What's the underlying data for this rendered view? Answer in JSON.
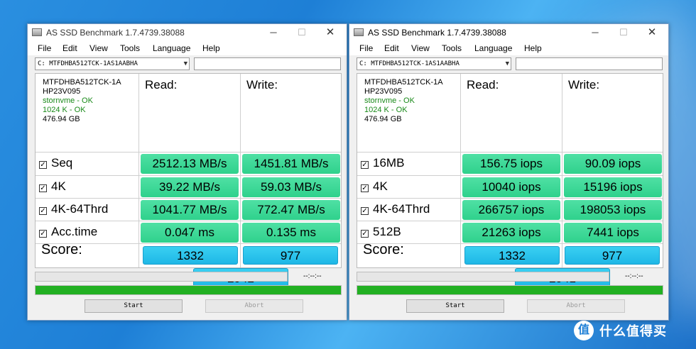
{
  "windows": [
    {
      "title": "AS SSD Benchmark 1.7.4739.38088",
      "menu": [
        "File",
        "Edit",
        "View",
        "Tools",
        "Language",
        "Help"
      ],
      "drive": "C: MTFDHBA512TCK-1AS1AABHA",
      "info": {
        "model": "MTFDHBA512TCK-1A",
        "firmware": "HP23V095",
        "driver": "stornvme - OK",
        "alignment": "1024 K - OK",
        "size": "476.94 GB"
      },
      "read_label": "Read:",
      "write_label": "Write:",
      "rows": [
        {
          "label": "Seq",
          "read": "2512.13 MB/s",
          "write": "1451.81 MB/s"
        },
        {
          "label": "4K",
          "read": "39.22 MB/s",
          "write": "59.03 MB/s"
        },
        {
          "label": "4K-64Thrd",
          "read": "1041.77 MB/s",
          "write": "772.47 MB/s"
        },
        {
          "label": "Acc.time",
          "read": "0.047 ms",
          "write": "0.135 ms"
        }
      ],
      "score_label": "Score:",
      "score_read": "1332",
      "score_write": "977",
      "score_total": "2942",
      "time_readout": "--:--:--",
      "progress": 100,
      "start_label": "Start",
      "abort_label": "Abort"
    },
    {
      "title": "AS SSD Benchmark 1.7.4739.38088",
      "menu": [
        "File",
        "Edit",
        "View",
        "Tools",
        "Language",
        "Help"
      ],
      "drive": "C: MTFDHBA512TCK-1AS1AABHA",
      "info": {
        "model": "MTFDHBA512TCK-1A",
        "firmware": "HP23V095",
        "driver": "stornvme - OK",
        "alignment": "1024 K - OK",
        "size": "476.94 GB"
      },
      "read_label": "Read:",
      "write_label": "Write:",
      "rows": [
        {
          "label": "16MB",
          "read": "156.75 iops",
          "write": "90.09 iops"
        },
        {
          "label": "4K",
          "read": "10040 iops",
          "write": "15196 iops"
        },
        {
          "label": "4K-64Thrd",
          "read": "266757 iops",
          "write": "198053 iops"
        },
        {
          "label": "512B",
          "read": "21263 iops",
          "write": "7441 iops"
        }
      ],
      "score_label": "Score:",
      "score_read": "1332",
      "score_write": "977",
      "score_total": "2941",
      "time_readout": "--:--:--",
      "progress": 100,
      "start_label": "Start",
      "abort_label": "Abort"
    }
  ],
  "checkbox_glyph": "☑",
  "watermark": {
    "logo": "值",
    "text": "什么值得买"
  },
  "colors": {
    "cell_green": "#3ddb98",
    "score_blue": "#2cc4ee",
    "progress_green": "#22b022"
  }
}
